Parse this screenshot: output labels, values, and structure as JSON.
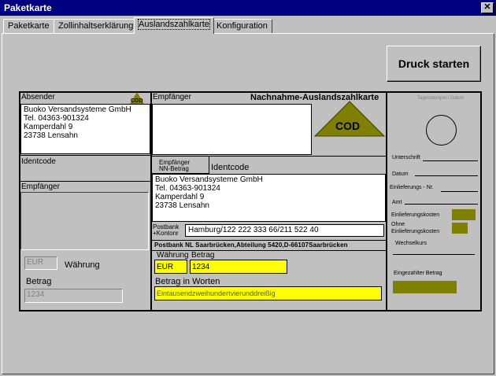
{
  "window": {
    "title": "Paketkarte",
    "close_glyph": "✕"
  },
  "tabs": [
    {
      "label": "Paketkarte"
    },
    {
      "label": "Zollinhaltserklärung"
    },
    {
      "label": "Auslandszahlkarte"
    },
    {
      "label": "Konfiguration"
    }
  ],
  "print_button": {
    "label": "Druck starten"
  },
  "form": {
    "header": "Nachnahme-Auslandszahlkarte",
    "cod_big": "COD",
    "cod_small": "COD",
    "absender_label": "Absender",
    "absender_lines": [
      "Buoko Versandsysteme GmbH",
      "Tel. 04363-901324",
      "Kamperdahl 9",
      "23738 Lensahn"
    ],
    "empfaenger_top_label": "Empfänger",
    "identcode_label": "Identcode",
    "empfaenger_left_label": "Empfänger",
    "waehrung_value": "EUR",
    "waehrung_label": "Währung",
    "betrag_label": "Betrag",
    "betrag_value": "1234",
    "nn_betrag_label_1": "Empfänger",
    "nn_betrag_label_2": "NN-Betrag",
    "identcode2_label": "Identcode",
    "empfaenger2_lines": [
      "Buoko Versandsysteme GmbH",
      "Tel. 04363-901324",
      "Kamperdahl 9",
      "23738 Lensahn"
    ],
    "postbank_label_1": "Postbank",
    "postbank_label_2": "+Kontonr",
    "postbank_value": "Hamburg/122 222 333 66/211 522 40",
    "postbank_addr": "Postbank NL Saarbrücken,Abteilung 5420,D-66107Saarbrücken",
    "waehrung2_label": "Währung",
    "betrag2_label": "Betrag",
    "waehrung2_value": "EUR",
    "betrag2_value": "1234",
    "betrag_worte_label": "Betrag in Worten",
    "betrag_worte_value": "Eintausendzweihundertvierunddreißig",
    "right": {
      "faint_top": "Tagesstempel / Datum",
      "unterschrift": "Unterschrift",
      "datum": "Datum",
      "einlieferungs_nr": "Einlieferungs - Nr.",
      "amt": "Amt",
      "einlieferungskosten": "Einlieferungskosten",
      "ohne_1": "Ohne",
      "ohne_2": "Einlieferungskosten",
      "wechselkurs": "Wechselkurs",
      "eingezahlter_betrag": "Eingezahlter Betrag"
    }
  },
  "colors": {
    "titlebar": "#000080",
    "field_yellow": "#ffff00",
    "cod_olive": "#808000"
  }
}
